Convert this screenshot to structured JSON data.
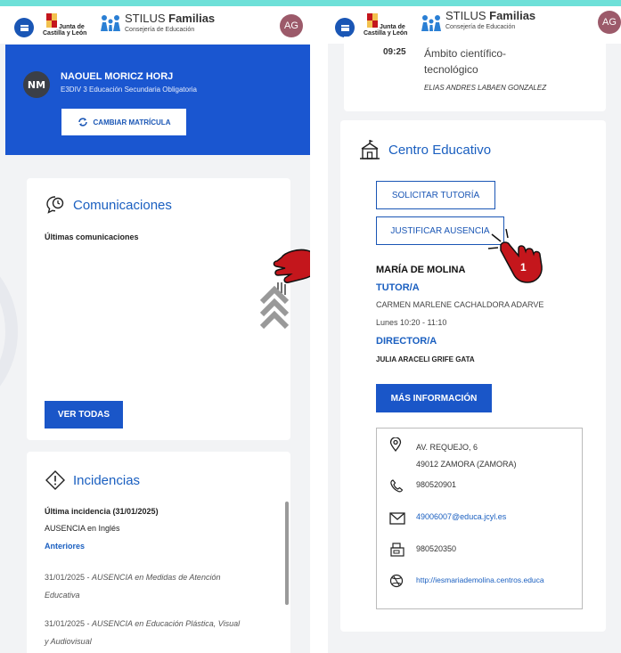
{
  "header": {
    "menu_icon": "menu-icon",
    "logo_text_1": "Junta de",
    "logo_text_2": "Castilla y León",
    "brand_light": "STILUS ",
    "brand_bold": "Familias",
    "brand_sub": "Consejería de Educación",
    "avatar_initials": "AG"
  },
  "student": {
    "initials": "NM",
    "name": "NAOUEL MORICZ HORJ",
    "course": "E3DIV 3 Educación Secundaria Obligatoria",
    "change_label": "CAMBIAR MATRÍCULA"
  },
  "communications": {
    "title": "Comunicaciones",
    "subtitle": "Últimas comunicaciones",
    "view_all": "VER TODAS"
  },
  "incidents": {
    "title": "Incidencias",
    "last_label": "Última incidencia (31/01/2025)",
    "last_detail": "AUSENCIA en Inglés",
    "previous_link": "Anteriores",
    "items": [
      {
        "date": "31/01/2025 - ",
        "text_l1": "AUSENCIA en Medidas de Atención",
        "text_l2": "Educativa"
      },
      {
        "date": "31/01/2025 - ",
        "text_l1": "AUSENCIA en Educación Plástica, Visual",
        "text_l2": "y Audiovisual"
      }
    ]
  },
  "schedule": {
    "time": "09:25",
    "subject_l1": "Ámbito científico-",
    "subject_l2": "tecnológico",
    "teacher": "ELIAS ANDRES LABAEN GONZALEZ"
  },
  "school": {
    "title": "Centro Educativo",
    "request_tutoring": "SOLICITAR TUTORÍA",
    "justify_absence": "JUSTIFICAR AUSENCIA",
    "name": "MARÍA DE MOLINA",
    "tutor_label": "TUTOR/A",
    "tutor_name": "CARMEN MARLENE CACHALDORA ADARVE",
    "tutor_hours": "Lunes 10:20 - 11:10",
    "director_label": "DIRECTOR/A",
    "director_name": "JULIA ARACELI GRIFE GATA",
    "more_info": "MÁS INFORMACIÓN",
    "address_l1": "AV. REQUEJO, 6",
    "address_l2": "49012 ZAMORA (ZAMORA)",
    "phone": "980520901",
    "email": "49006007@educa.jcyl.es",
    "fax": "980520350",
    "website": "http://iesmariademolina.centros.educa"
  },
  "annotation": {
    "step_number": "1"
  },
  "colors": {
    "primary_blue": "#1a56c8",
    "band_blue": "#1a56d0",
    "avatar": "#9c5a6a",
    "hand_red": "#c4161c",
    "top_band": "#6ee0d8"
  }
}
